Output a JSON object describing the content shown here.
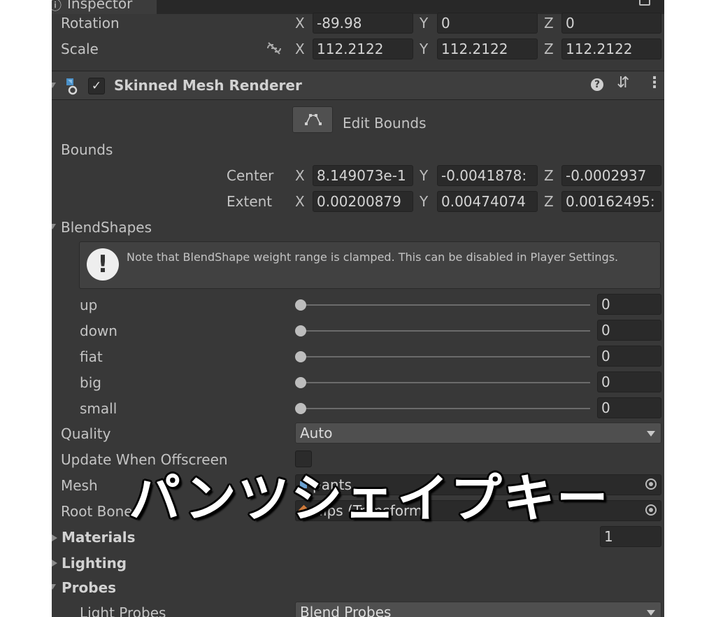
{
  "window": {
    "tab_title": "Inspector"
  },
  "transform": {
    "rotation": {
      "label": "Rotation",
      "x": "-89.98",
      "y": "0",
      "z": "0"
    },
    "scale": {
      "label": "Scale",
      "x": "112.2122",
      "y": "112.2122",
      "z": "112.2122"
    }
  },
  "axes": {
    "x": "X",
    "y": "Y",
    "z": "Z"
  },
  "component": {
    "title": "Skinned Mesh Renderer",
    "enabled_check": "✓",
    "edit_bounds_label": "Edit Bounds"
  },
  "bounds": {
    "label": "Bounds",
    "center": {
      "label": "Center",
      "x": "8.149073e-1",
      "y": "-0.0041878:",
      "z": "-0.0002937"
    },
    "extent": {
      "label": "Extent",
      "x": "0.00200879",
      "y": "0.00474074",
      "z": "0.00162495:"
    }
  },
  "blendshapes": {
    "label": "BlendShapes",
    "note": "Note that BlendShape weight range is clamped. This can be disabled in Player Settings.",
    "items": [
      {
        "name": "up",
        "value": "0"
      },
      {
        "name": "down",
        "value": "0"
      },
      {
        "name": "fiat",
        "value": "0"
      },
      {
        "name": "big",
        "value": "0"
      },
      {
        "name": "small",
        "value": "0"
      }
    ]
  },
  "quality": {
    "label": "Quality",
    "value": "Auto"
  },
  "update_offscreen": {
    "label": "Update When Offscreen"
  },
  "mesh": {
    "label": "Mesh",
    "value": "pants"
  },
  "root_bone": {
    "label": "Root Bone",
    "value": "Hips (Transform)"
  },
  "sections": {
    "materials": {
      "label": "Materials",
      "count": "1"
    },
    "lighting": {
      "label": "Lighting"
    },
    "probes": {
      "label": "Probes"
    }
  },
  "light_probes": {
    "label": "Light Probes",
    "value": "Blend Probes"
  },
  "overlay_caption": "パンツシェイプキー",
  "colors": {
    "panel_bg": "#383838",
    "field_bg": "#2a2a2a",
    "accent_icon": "#4a90c8"
  }
}
